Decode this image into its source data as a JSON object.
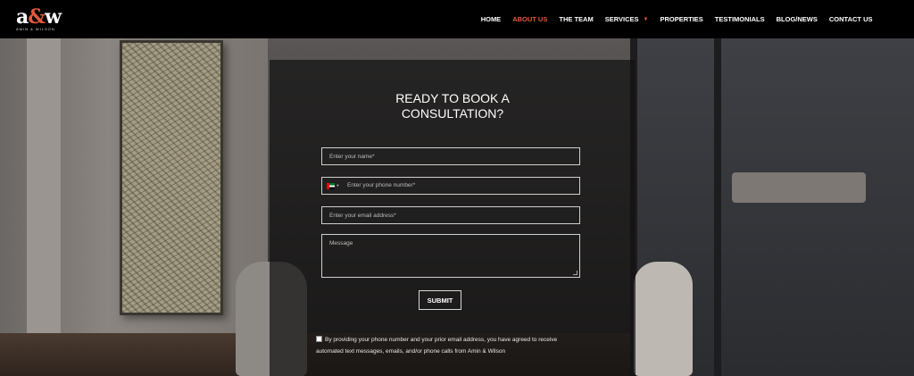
{
  "brand": {
    "logo_mark_a": "a",
    "logo_mark_amp": "&",
    "logo_mark_w": "w",
    "logo_sub": "Amin & Wilson"
  },
  "nav": {
    "items": [
      {
        "label": "HOME"
      },
      {
        "label": "ABOUT US",
        "active": true
      },
      {
        "label": "THE TEAM"
      },
      {
        "label": "SERVICES",
        "has_dropdown": true
      },
      {
        "label": "PROPERTIES"
      },
      {
        "label": "TESTIMONIALS"
      },
      {
        "label": "BLOG/NEWS"
      },
      {
        "label": "CONTACT US"
      }
    ],
    "active_color": "#e25a3c"
  },
  "form": {
    "title_line1": "READY TO BOOK A",
    "title_line2": "CONSULTATION?",
    "name_placeholder": "Enter your name*",
    "phone_placeholder": "Enter your phone number*",
    "phone_country_icon": "uae-flag-icon",
    "email_placeholder": "Enter your email address*",
    "message_placeholder": "Message",
    "submit_label": "SUBMIT",
    "consent_text": "By providing your phone number and your prior email address, you have agreed to receive automated text messages, emails, and/or phone calls from Amin & Wilson"
  }
}
